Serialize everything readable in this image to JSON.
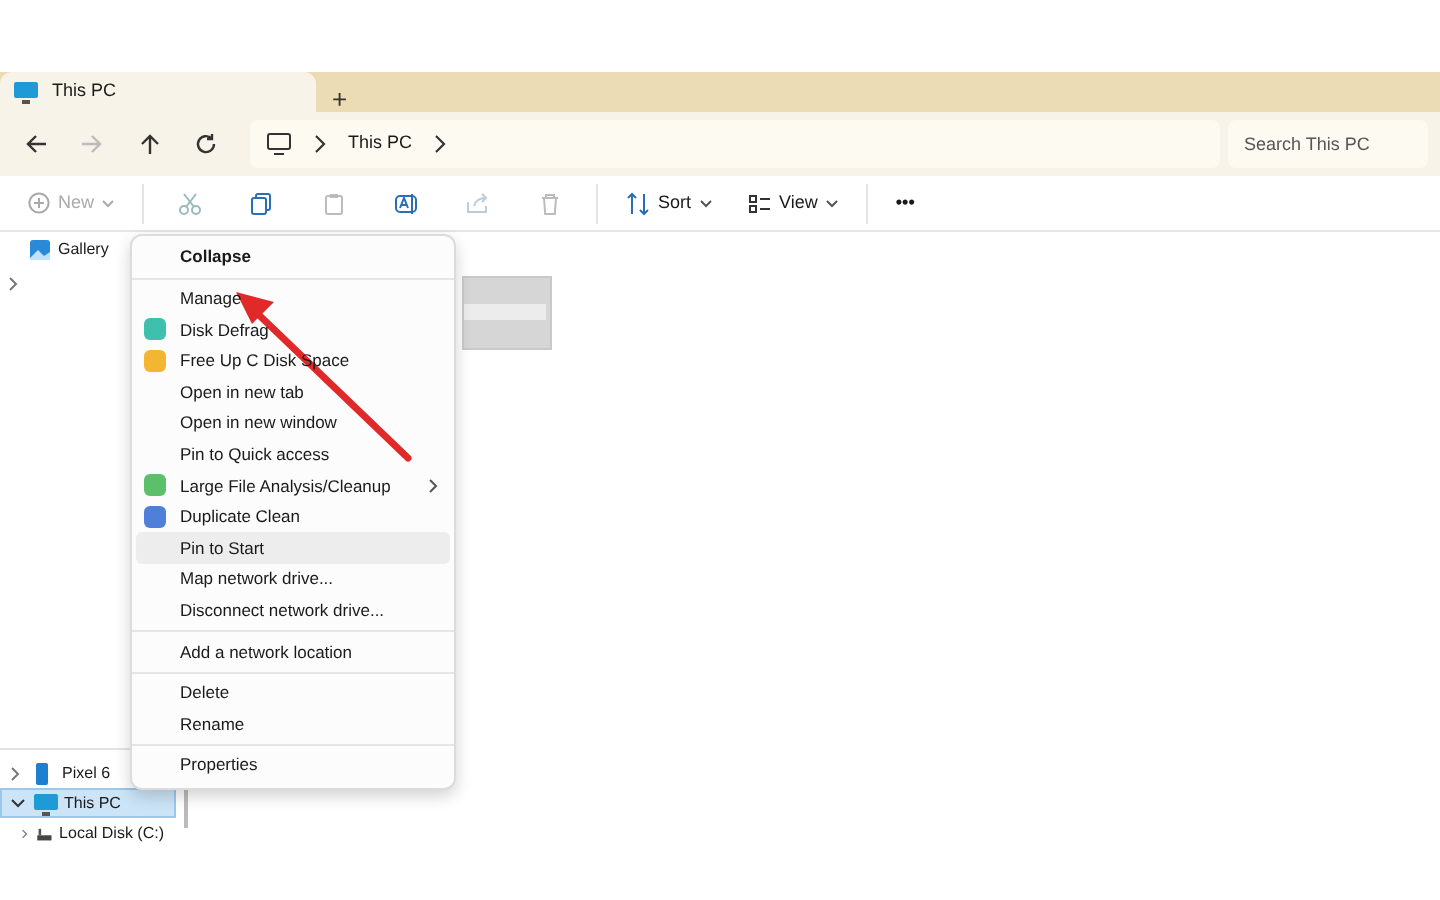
{
  "tabs": [
    {
      "label": "This PC",
      "selected": true
    }
  ],
  "new_tab": "+",
  "address": {
    "breadcrumb": [
      "This PC"
    ]
  },
  "search": {
    "placeholder": "Search This PC"
  },
  "toolbar": {
    "new": "New",
    "sort": "Sort",
    "view": "View",
    "more": "•••"
  },
  "sidebar": {
    "top": [
      {
        "label": "Gallery",
        "kind": "gallery"
      }
    ],
    "bottom": [
      {
        "label": "Pixel 6",
        "kind": "phone",
        "expanded": false,
        "selected": false
      },
      {
        "label": "This PC",
        "kind": "pc",
        "expanded": true,
        "selected": true,
        "children": [
          {
            "label": "Local Disk (C:)",
            "kind": "disk",
            "expanded": false,
            "selected": false
          }
        ]
      }
    ]
  },
  "context_menu": {
    "items": [
      {
        "label": "Collapse",
        "kind": "bold",
        "highlighted": false
      },
      {
        "kind": "separator"
      },
      {
        "label": "Manage",
        "kind": "plain",
        "highlighted": false
      },
      {
        "label": "Disk Defrag",
        "kind": "icon",
        "color": "#3fbfae",
        "highlighted": false
      },
      {
        "label": "Free Up C Disk Space",
        "kind": "icon",
        "color": "#f2b632",
        "highlighted": false
      },
      {
        "label": "Open in new tab",
        "kind": "plain",
        "highlighted": false
      },
      {
        "label": "Open in new window",
        "kind": "plain",
        "highlighted": false
      },
      {
        "label": "Pin to Quick access",
        "kind": "plain",
        "highlighted": false
      },
      {
        "label": "Large File Analysis/Cleanup",
        "kind": "submenu",
        "color": "#5cbf6a",
        "highlighted": false
      },
      {
        "label": "Duplicate Clean",
        "kind": "icon",
        "color": "#4f7fd9",
        "highlighted": false
      },
      {
        "label": "Pin to Start",
        "kind": "plain",
        "highlighted": true
      },
      {
        "label": "Map network drive...",
        "kind": "plain",
        "highlighted": false
      },
      {
        "label": "Disconnect network drive...",
        "kind": "plain",
        "highlighted": false
      },
      {
        "kind": "separator"
      },
      {
        "label": "Add a network location",
        "kind": "plain",
        "highlighted": false
      },
      {
        "kind": "separator"
      },
      {
        "label": "Delete",
        "kind": "plain",
        "highlighted": false
      },
      {
        "label": "Rename",
        "kind": "plain",
        "highlighted": false
      },
      {
        "kind": "separator"
      },
      {
        "label": "Properties",
        "kind": "plain",
        "highlighted": false
      }
    ]
  }
}
